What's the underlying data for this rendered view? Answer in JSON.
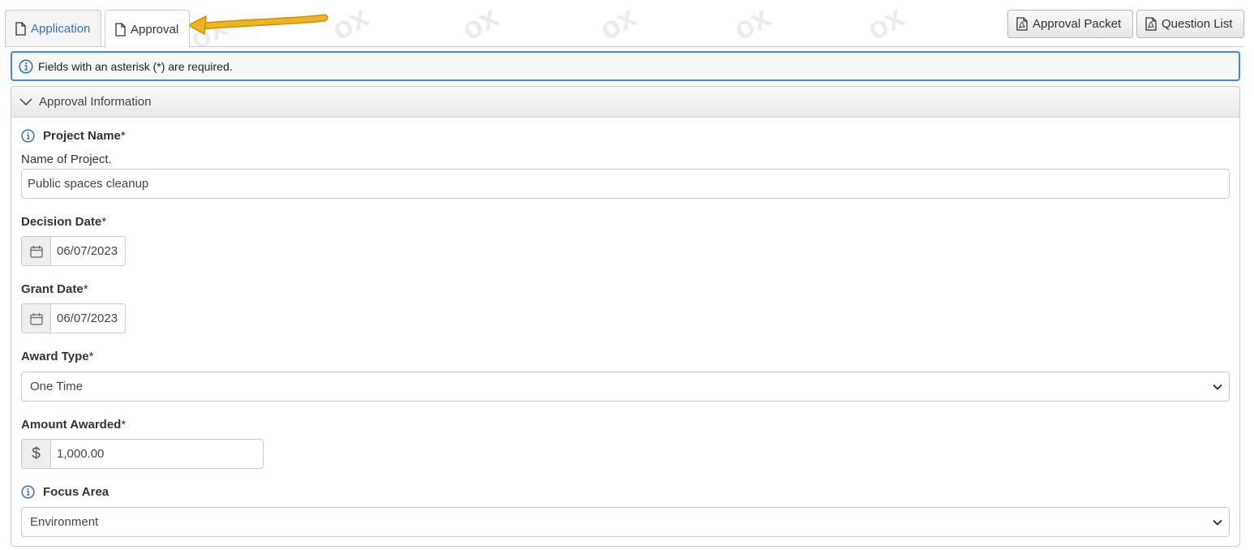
{
  "tabs": [
    {
      "label": "Application"
    },
    {
      "label": "Approval"
    }
  ],
  "buttons": {
    "approval_packet": "Approval Packet",
    "question_list": "Question List"
  },
  "notice": "Fields with an asterisk (*) are required.",
  "section": {
    "title": "Approval Information"
  },
  "fields": {
    "project_name": {
      "label": "Project Name",
      "required_mark": "*",
      "help": "Name of Project.",
      "value": "Public spaces cleanup"
    },
    "decision_date": {
      "label": "Decision Date",
      "required_mark": "*",
      "value": "06/07/2023"
    },
    "grant_date": {
      "label": "Grant Date",
      "required_mark": "*",
      "value": "06/07/2023"
    },
    "award_type": {
      "label": "Award Type",
      "required_mark": "*",
      "value": "One Time"
    },
    "amount_awarded": {
      "label": "Amount Awarded",
      "required_mark": "*",
      "currency": "$",
      "value": "1,000.00"
    },
    "focus_area": {
      "label": "Focus Area",
      "value": "Environment"
    }
  },
  "colors": {
    "accent": "#3a72b5",
    "notice_border": "#4a86d6",
    "arrow": "#f0b41c"
  }
}
